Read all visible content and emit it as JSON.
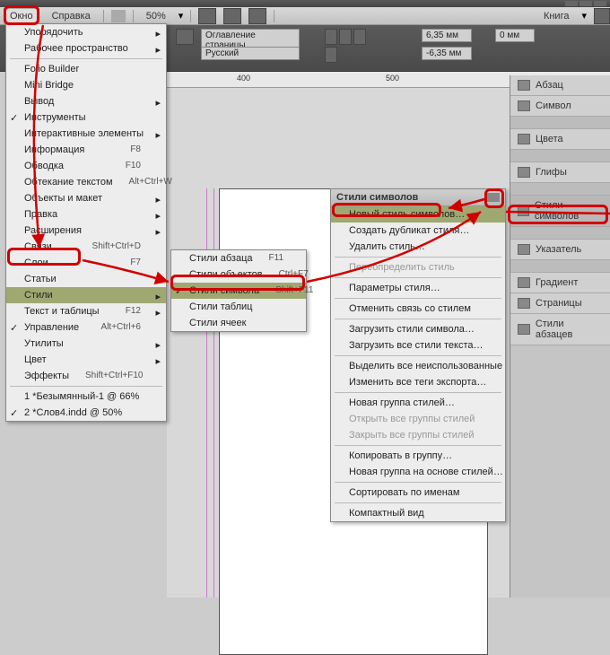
{
  "menubar": {
    "window": "Окно",
    "help": "Справка",
    "zoom": "50%",
    "book": "Книга"
  },
  "controlbar": {
    "toc": "Оглавление страницы",
    "lang": "Русский",
    "xoff": "6,35 мм",
    "xoff2": "-6,35 мм",
    "yoff": "0 мм"
  },
  "ruler": {
    "t400": "400",
    "t500": "500"
  },
  "window_menu": {
    "arrange": "Упорядочить",
    "workspace": "Рабочее пространство",
    "folio": "Folio Builder",
    "minibridge": "Mini Bridge",
    "output": "Вывод",
    "tools": "Инструменты",
    "interactive": "Интерактивные элементы",
    "info": "Информация",
    "info_sc": "F8",
    "wrap": "Обводка",
    "wrap_sc": "F10",
    "textwrap": "Обтекание текстом",
    "textwrap_sc": "Alt+Ctrl+W",
    "obj": "Объекты и макет",
    "edit": "Правка",
    "ext": "Расширения",
    "links": "Связи",
    "links_sc": "Shift+Ctrl+D",
    "layers": "Слои",
    "layers_sc": "F7",
    "article": "Статьи",
    "styles": "Стили",
    "texttables": "Текст и таблицы",
    "control": "Управление",
    "control_sc": "Alt+Ctrl+6",
    "utils": "Утилиты",
    "color": "Цвет",
    "effects": "Эффекты",
    "effects_sc": "Shift+Ctrl+F10",
    "doc1": "1 *Безымянный-1 @ 66%",
    "doc2": "2 *Слов4.indd @ 50%"
  },
  "styles_sub": {
    "para": "Стили абзаца",
    "para_sc": "F11",
    "obj": "Стили объектов",
    "obj_sc": "Ctrl+F7",
    "char": "Стили символа",
    "char_sc": "Shift+F11",
    "table": "Стили таблиц",
    "cell": "Стили ячеек"
  },
  "charstyle_panel": {
    "title": "Стили символов",
    "new": "Новый стиль символов…",
    "dup": "Создать дубликат стиля…",
    "del": "Удалить стиль…",
    "redef": "Переопределить стиль",
    "opts": "Параметры стиля…",
    "unlink": "Отменить связь со стилем",
    "loadchar": "Загрузить стили символа…",
    "loadall": "Загрузить все стили текста…",
    "unused": "Выделить все неиспользованные",
    "tags": "Изменить все теги экспорта…",
    "newgroup": "Новая группа стилей…",
    "openall": "Открыть все группы стилей",
    "closeall": "Закрыть все группы стилей",
    "copyto": "Копировать в группу…",
    "groupfrom": "Новая группа на основе стилей…",
    "sort": "Сортировать по именам",
    "compact": "Компактный вид"
  },
  "panels": {
    "para": "Абзац",
    "char": "Символ",
    "colors": "Цвета",
    "glyphs": "Глифы",
    "charstyles": "Стили символов",
    "index": "Указатель",
    "gradient": "Градиент",
    "pages": "Страницы",
    "parastyles": "Стили абзацев"
  }
}
